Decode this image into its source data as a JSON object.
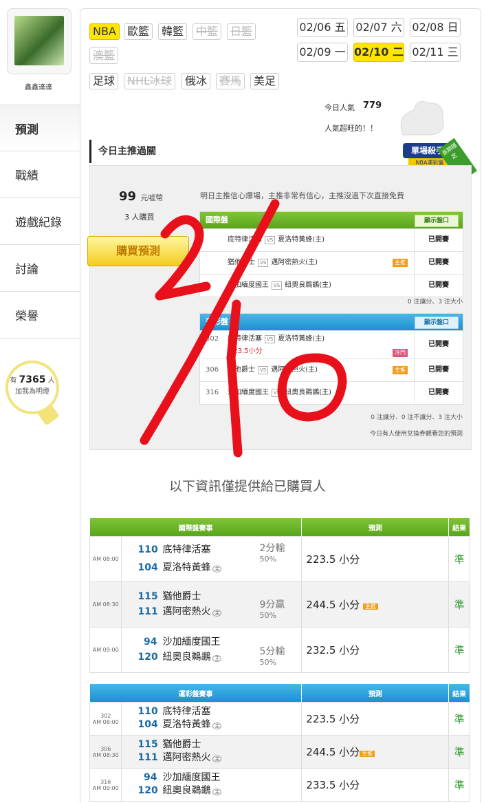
{
  "sidebar": {
    "username": "鑫鑫達達",
    "nav": [
      "預測",
      "戰績",
      "遊戲紀錄",
      "討論",
      "榮譽"
    ],
    "bulb": {
      "prefix": "有",
      "count": "7365",
      "suffix": "人",
      "text": "加我為明燈"
    }
  },
  "sports": {
    "row1": [
      "NBA",
      "歐籃",
      "韓籃",
      "中籃",
      "日籃"
    ],
    "row2": [
      "澳籃"
    ],
    "row3": [
      "足球",
      "NHL冰球",
      "俄冰",
      "賽馬",
      "美足"
    ]
  },
  "dates": {
    "row1": [
      "02/06 五",
      "02/07 六",
      "02/08 日"
    ],
    "row2": [
      "02/09 一",
      "02/10 二",
      "02/11 三"
    ]
  },
  "popularity": {
    "label": "今日人氣",
    "value": "779",
    "note": "人氣超旺的！！"
  },
  "section_title": "今日主推過關",
  "badge": {
    "top": "單場殺手",
    "bottom": "NBA運彩盤",
    "ribbon": "長期穩定"
  },
  "offer": {
    "price": "99",
    "unit": "元嘘幣",
    "buyers": "3 人購買",
    "buy_button": "購買預測",
    "note": "明日主推信心爆場，主推非常有信心，主推沒過下次直接免費"
  },
  "intl_panel": {
    "title": "國際盤",
    "show_button": "顯示盤口",
    "rows": [
      {
        "home": "底特律活塞",
        "away": "夏洛特黃蜂(主)",
        "status": "已開賽"
      },
      {
        "home": "猶他爵士",
        "away": "邁阿密熱火(主)",
        "status": "已開賽",
        "tag": "主推"
      },
      {
        "home": "沙加緬度國王",
        "away": "紐奧良鵜鶘(主)",
        "status": "已開賽"
      }
    ],
    "summary": "0 注讓分、3 注大小"
  },
  "lottery_panel": {
    "title": "運彩盤",
    "show_button": "顯示盤口",
    "rows": [
      {
        "num": "302",
        "home": "底特律活塞",
        "away": "夏洛特黃蜂(主)",
        "extra": "223.5小分",
        "status": "已開賽",
        "tag": "冷門"
      },
      {
        "num": "306",
        "home": "猶他爵士",
        "away": "邁阿密熱火(主)",
        "status": "已開賽",
        "tag": "主推"
      },
      {
        "num": "316",
        "home": "沙加緬度國王",
        "away": "紐奧良鵜鶘(主)",
        "status": "已開賽"
      }
    ],
    "summary": "0 注讓分、0 注不讓分、3 注大小",
    "note": "今日有人使用兌換券觀看您的預測"
  },
  "purchased_note": "以下資訊僅提供給已購買人",
  "intl_table": {
    "headers": [
      "國際盤賽事",
      "預測",
      "結果"
    ],
    "rows": [
      {
        "time": "AM 08:00",
        "s1": "110",
        "t1": "底特律活塞",
        "s2": "104",
        "t2": "夏洛特黃蜂",
        "spread": "2分輸",
        "pct": "50%",
        "pred": "223.5 小分",
        "res": "準"
      },
      {
        "time": "AM 08:30",
        "s1": "115",
        "t1": "猶他爵士",
        "s2": "111",
        "t2": "邁阿密熱火",
        "spread": "9分贏",
        "pct": "50%",
        "pred": "244.5 小分",
        "res": "準",
        "tag": "主推"
      },
      {
        "time": "AM 09:00",
        "s1": "94",
        "t1": "沙加緬度國王",
        "s2": "120",
        "t2": "紐奧良鵜鶘",
        "spread": "5分輸",
        "pct": "50%",
        "pred": "232.5 小分",
        "res": "準"
      }
    ]
  },
  "lottery_table": {
    "headers": [
      "運彩盤賽事",
      "預測",
      "結果"
    ],
    "rows": [
      {
        "num": "302",
        "time": "AM 08:00",
        "s1": "110",
        "t1": "底特律活塞",
        "s2": "104",
        "t2": "夏洛特黃蜂",
        "pred": "223.5 小分",
        "res": "準"
      },
      {
        "num": "306",
        "time": "AM 08:30",
        "s1": "115",
        "t1": "猶他爵士",
        "s2": "111",
        "t2": "邁阿密熱火",
        "pred": "244.5 小分",
        "res": "準",
        "tag": "主推"
      },
      {
        "num": "316",
        "time": "AM 09:00",
        "s1": "94",
        "t1": "沙加緬度國王",
        "s2": "120",
        "t2": "紐奧良鵜鶘",
        "pred": "233.5 小分",
        "res": "準"
      }
    ]
  },
  "host_mark": "主",
  "handwritten_annotation": "2/10",
  "colors": {
    "accent_yellow": "#ffe600",
    "green": "#5aa519",
    "blue": "#1e90d0",
    "annotation_red": "#e8101a",
    "score_blue": "#1b6aa5",
    "result_green": "#2a9a2a"
  }
}
